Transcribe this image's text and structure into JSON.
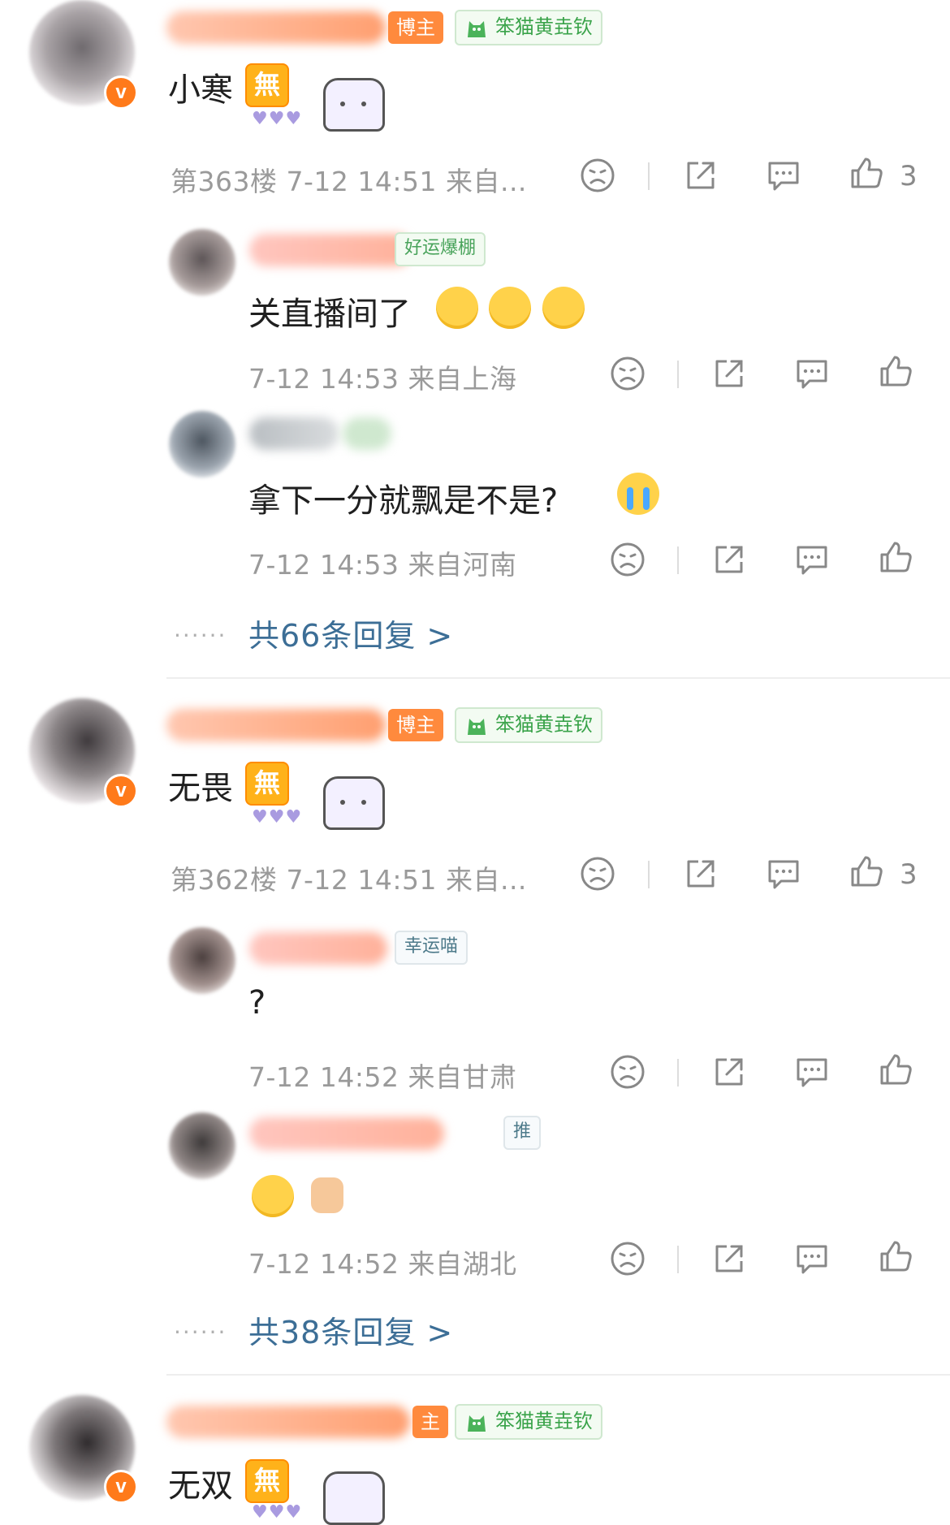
{
  "threads": [
    {
      "main": {
        "host_tag": "博主",
        "group_tag": "笨猫黄垚钦",
        "text": "小寒",
        "badge_char": "無",
        "meta": "第363楼 7-12 14:51 来自...",
        "likes": "3"
      },
      "replies": [
        {
          "tag": "好运爆棚",
          "text": "关直播间了",
          "meta": "7-12 14:53 来自上海"
        },
        {
          "tag": "",
          "text": "拿下一分就飘是不是?",
          "meta": "7-12 14:53 来自河南"
        }
      ],
      "more": "共66条回复 >"
    },
    {
      "main": {
        "host_tag": "博主",
        "group_tag": "笨猫黄垚钦",
        "text": "无畏",
        "badge_char": "無",
        "meta": "第362楼 7-12 14:51 来自...",
        "likes": "3"
      },
      "replies": [
        {
          "tag": "幸运喵",
          "text": "?",
          "meta": "7-12 14:52 来自甘肃"
        },
        {
          "tag": "推",
          "text": "",
          "meta": "7-12 14:52 来自湖北"
        }
      ],
      "more": "共38条回复 >"
    },
    {
      "main": {
        "host_tag": "主",
        "group_tag": "笨猫黄垚钦",
        "text": "无双",
        "badge_char": "無"
      }
    }
  ],
  "dots": "......",
  "colors": {
    "accent_orange": "#ff8a3d",
    "link_blue": "#3c6e96",
    "meta_gray": "#9a9a9a",
    "green_tag": "#3aa34a"
  },
  "icons": [
    "dislike-face-icon",
    "share-icon",
    "comment-icon",
    "thumb-up-icon",
    "verified-v-icon",
    "cat-icon"
  ]
}
